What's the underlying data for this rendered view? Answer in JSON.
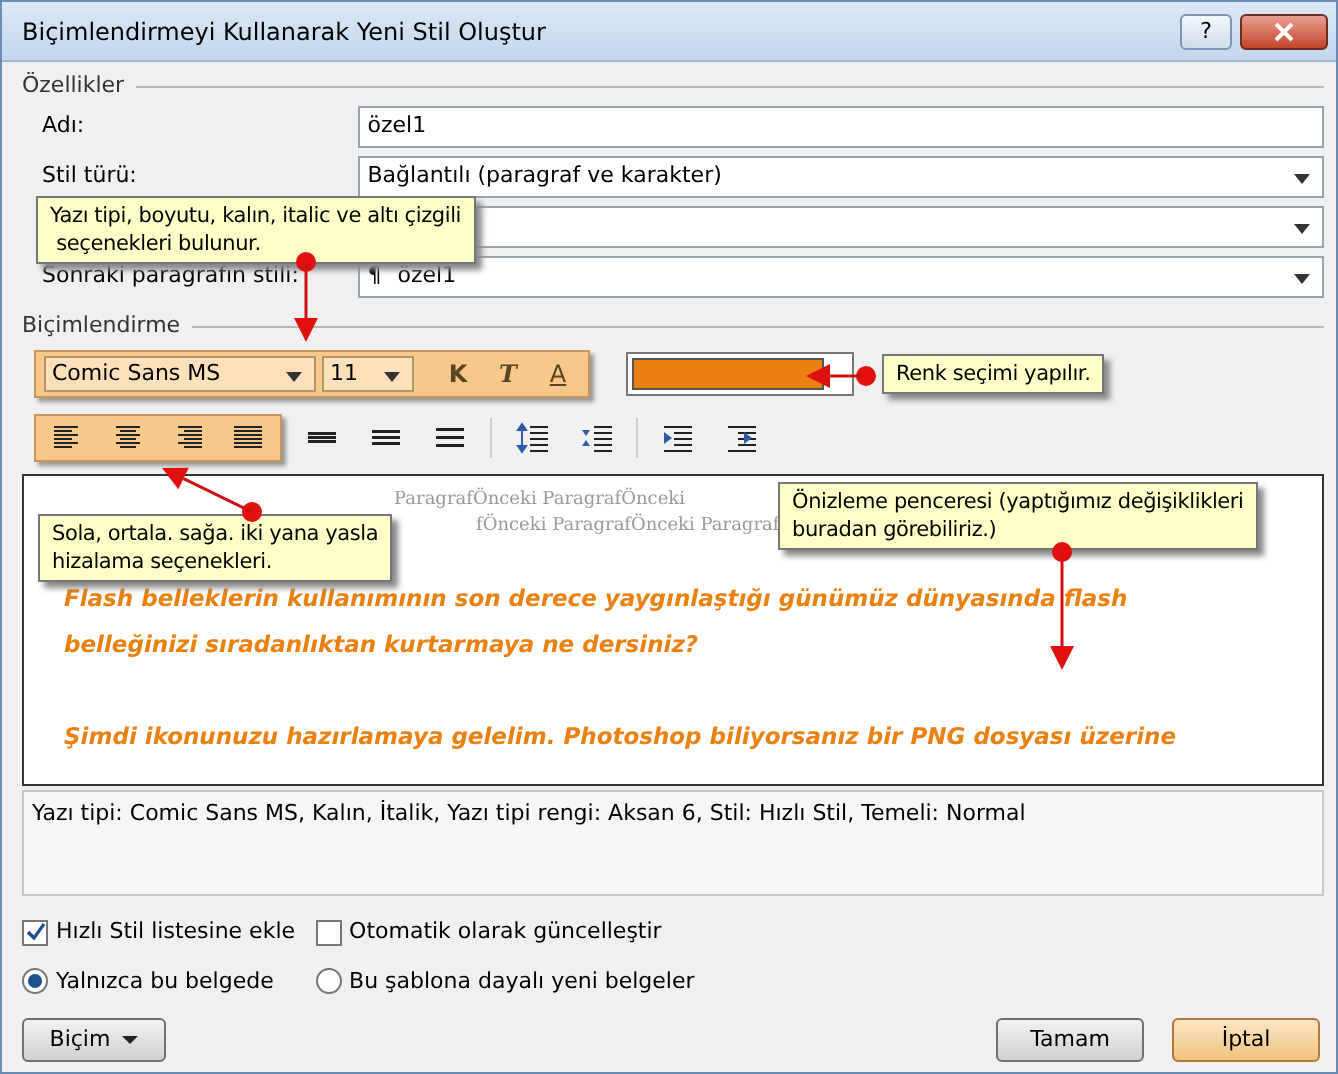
{
  "window": {
    "title": "Biçimlendirmeyi Kullanarak Yeni Stil Oluştur",
    "help": "?"
  },
  "properties": {
    "legend": "Özellikler",
    "fields": [
      {
        "label": "Adı:",
        "value": "özel1",
        "kind": "text"
      },
      {
        "label": "Stil türü:",
        "value": "Bağlantılı (paragraf ve karakter)",
        "kind": "select"
      },
      {
        "kind": "select"
      },
      {
        "label": "Sonraki paragrafın stili:",
        "value": "özel1",
        "kind": "select",
        "pilcrow": "¶"
      }
    ]
  },
  "formatting": {
    "legend": "Biçimlendirme",
    "font": "Comic Sans MS",
    "size": "11",
    "bold": "K",
    "italic": "T",
    "color_letter": "A",
    "color": "#e98010",
    "preview_before": [
      "ParagrafÖnceki ParagrafÖnceki",
      "fÖnceki ParagrafÖnceki Paragraf"
    ],
    "preview_paragraphs": [
      [
        "Flash belleklerin kullanımının son derece yaygınlaştığı günümüz dünyasında flash",
        "belleğinizi sıradanlıktan kurtarmaya ne dersiniz?"
      ],
      [
        "Şimdi ikonunuzu hazırlamaya gelelim. Photoshop biliyorsanız bir PNG dosyası üzerine"
      ]
    ],
    "description": "Yazı tipi: Comic Sans MS, Kalın, İtalik, Yazı tipi rengi: Aksan 6, Stil: Hızlı Stil, Temeli: Normal"
  },
  "options": [
    {
      "label": "Hızlı Stil listesine ekle",
      "kind": "checkbox",
      "checked": true
    },
    {
      "label": "Otomatik olarak güncelleştir",
      "kind": "checkbox",
      "checked": false
    },
    {
      "label": "Yalnızca bu belgede",
      "kind": "radio",
      "selected": true
    },
    {
      "label": "Bu şablona dayalı yeni belgeler",
      "kind": "radio",
      "selected": false
    }
  ],
  "buttons": {
    "format": "Biçim",
    "ok": "Tamam",
    "cancel": "İptal"
  },
  "callouts": [
    {
      "text": "Yazı tipi, boyutu, kalın, italic ve altı çizgili\n seçenekleri bulunur."
    },
    {
      "text": "Renk seçimi yapılır."
    },
    {
      "text": "Sola, ortala. sağa. iki yana yasla\nhizalama seçenekleri."
    },
    {
      "text": "Önizleme penceresi (yaptığımız değişiklikleri\nburadan görebiliriz.)"
    }
  ]
}
